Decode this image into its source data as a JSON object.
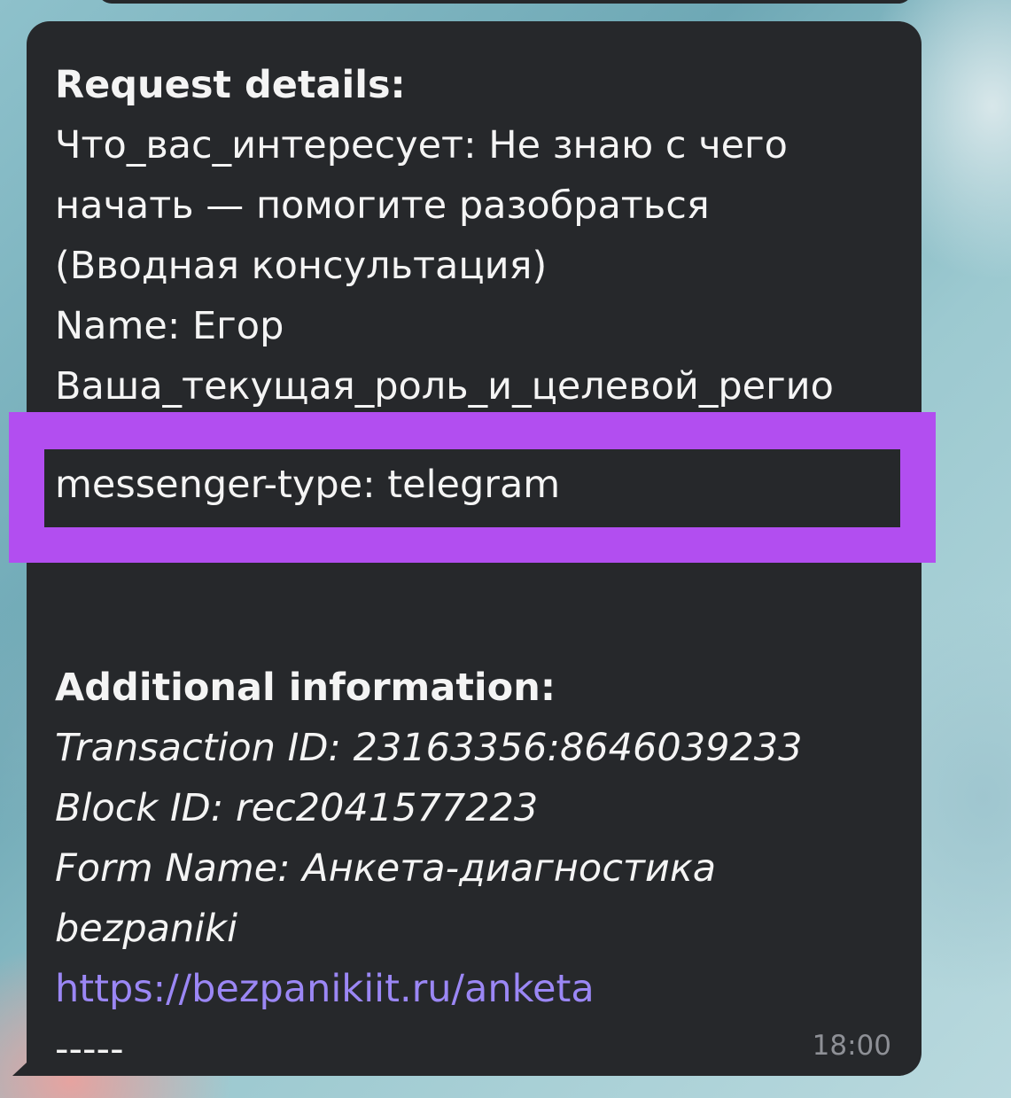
{
  "message": {
    "heading": "Request details:",
    "lines": [
      "Что_вас_интересует: Не знаю с чего",
      "начать — помогите разобраться",
      "(Вводная консультация)",
      "Name: Егор",
      "Ваша_текущая_роль_и_целевой_регио"
    ],
    "highlighted_line": "messenger-type: telegram",
    "additional_heading": "Additional information:",
    "additional_lines": [
      "Transaction ID: 23163356:8646039233",
      "Block ID: rec2041577223",
      "Form Name: Анкета-диагностика",
      "bezpaniki"
    ],
    "link": "https://bezpanikiit.ru/anketa",
    "separator": "-----",
    "time": "18:00"
  },
  "colors": {
    "bubble": "#26282b",
    "highlight": "#b24ef0",
    "link": "#9b87f5",
    "time": "#8e9096"
  }
}
